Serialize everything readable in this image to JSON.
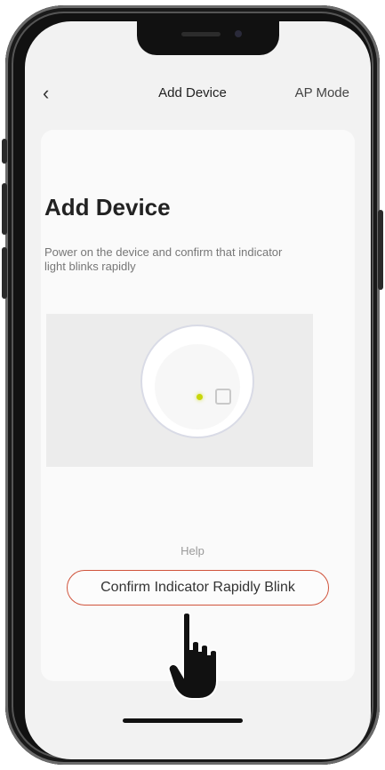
{
  "nav": {
    "back_icon": "chevron-left-icon",
    "title": "Add Device",
    "right_label": "AP Mode"
  },
  "card": {
    "title": "Add Device",
    "description": "Power on the device and confirm that indicator light blinks rapidly"
  },
  "help_label": "Help",
  "confirm_button_label": "Confirm Indicator Rapidly Blink",
  "colors": {
    "accent_border": "#d0533b",
    "indicator": "#c8d60a"
  }
}
